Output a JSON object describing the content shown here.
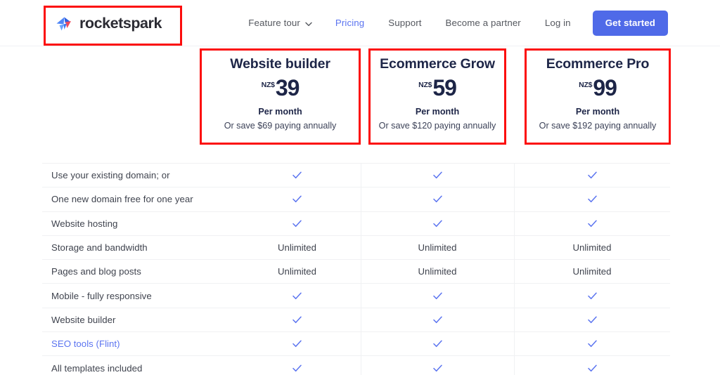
{
  "brand": {
    "name": "rocketspark",
    "logo_icon": "rocketspark-logo-icon",
    "logo_colors": {
      "blue": "#4f86f7",
      "red": "#f04a5a",
      "dark_blue": "#2f5fe0"
    }
  },
  "nav": {
    "items": [
      {
        "label": "Feature tour",
        "active": false,
        "caret": true
      },
      {
        "label": "Pricing",
        "active": true,
        "caret": false
      },
      {
        "label": "Support",
        "active": false,
        "caret": false
      },
      {
        "label": "Become a partner",
        "active": false,
        "caret": false
      },
      {
        "label": "Log in",
        "active": false,
        "caret": false
      }
    ],
    "cta_label": "Get started",
    "cta_color": "#4f6ae8",
    "active_color": "#5b74f0"
  },
  "plans": [
    {
      "name": "Website builder",
      "currency": "NZ$",
      "amount": "39",
      "period": "Per month",
      "annual_note": "Or save $69 paying annually"
    },
    {
      "name": "Ecommerce Grow",
      "currency": "NZ$",
      "amount": "59",
      "period": "Per month",
      "annual_note": "Or save $120 paying annually"
    },
    {
      "name": "Ecommerce Pro",
      "currency": "NZ$",
      "amount": "99",
      "period": "Per month",
      "annual_note": "Or save $192 paying annually"
    }
  ],
  "features": [
    {
      "name": "Use your existing domain; or",
      "link": false,
      "values": [
        "check",
        "check",
        "check"
      ]
    },
    {
      "name": "One new domain free for one year",
      "link": false,
      "values": [
        "check",
        "check",
        "check"
      ]
    },
    {
      "name": "Website hosting",
      "link": false,
      "values": [
        "check",
        "check",
        "check"
      ]
    },
    {
      "name": "Storage and bandwidth",
      "link": false,
      "values": [
        "Unlimited",
        "Unlimited",
        "Unlimited"
      ]
    },
    {
      "name": "Pages and blog posts",
      "link": false,
      "values": [
        "Unlimited",
        "Unlimited",
        "Unlimited"
      ]
    },
    {
      "name": "Mobile - fully responsive",
      "link": false,
      "values": [
        "check",
        "check",
        "check"
      ]
    },
    {
      "name": "Website builder",
      "link": false,
      "values": [
        "check",
        "check",
        "check"
      ]
    },
    {
      "name": "SEO tools (Flint)",
      "link": true,
      "values": [
        "check",
        "check",
        "check"
      ]
    },
    {
      "name": "All templates included",
      "link": false,
      "values": [
        "check",
        "check",
        "check"
      ]
    }
  ],
  "style": {
    "check_color": "#5b74f0",
    "text_color": "#3f434e",
    "heading_color": "#1d2547",
    "rule_color": "#f0f1f3",
    "annotation_color": "#fc0d0d"
  },
  "annotations": [
    {
      "name": "logo-highlight",
      "target": "brand logo"
    },
    {
      "name": "plan1-highlight",
      "target": "Website builder price card"
    },
    {
      "name": "plan2-highlight",
      "target": "Ecommerce Grow price card"
    },
    {
      "name": "plan3-highlight",
      "target": "Ecommerce Pro price card"
    }
  ]
}
